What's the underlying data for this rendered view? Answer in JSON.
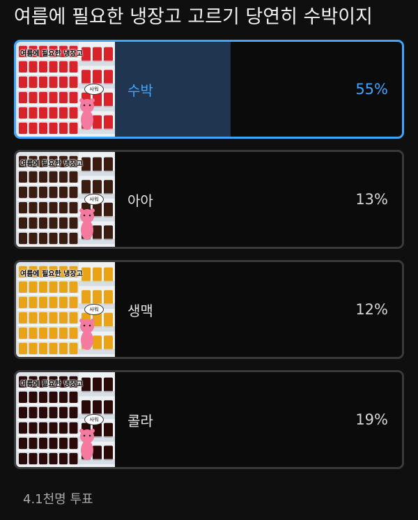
{
  "poll": {
    "title": "여름에 필요한 냉장고 고르기 당연히 수박이지",
    "votes": "4.1천명 투표",
    "options": [
      {
        "label": "수박",
        "percent": "55%",
        "fill": 0.55,
        "selected": true,
        "caption": "여름에 필요한 냉장고",
        "bubble": "사워",
        "item_color": "#d8232a"
      },
      {
        "label": "아아",
        "percent": "13%",
        "fill": 0.13,
        "selected": false,
        "caption": "여름에 필요한 냉장고",
        "bubble": "사워",
        "item_color": "#3a1d10"
      },
      {
        "label": "생맥",
        "percent": "12%",
        "fill": 0.12,
        "selected": false,
        "caption": "여름에 필요한 냉장고",
        "bubble": "사워",
        "item_color": "#e9a317"
      },
      {
        "label": "콜라",
        "percent": "19%",
        "fill": 0.19,
        "selected": false,
        "caption": "여름에 필요한 냉장고",
        "bubble": "사워",
        "item_color": "#2a0a08"
      }
    ]
  },
  "colors": {
    "accent": "#3ea6ff",
    "mascot": "#f47aa0"
  }
}
